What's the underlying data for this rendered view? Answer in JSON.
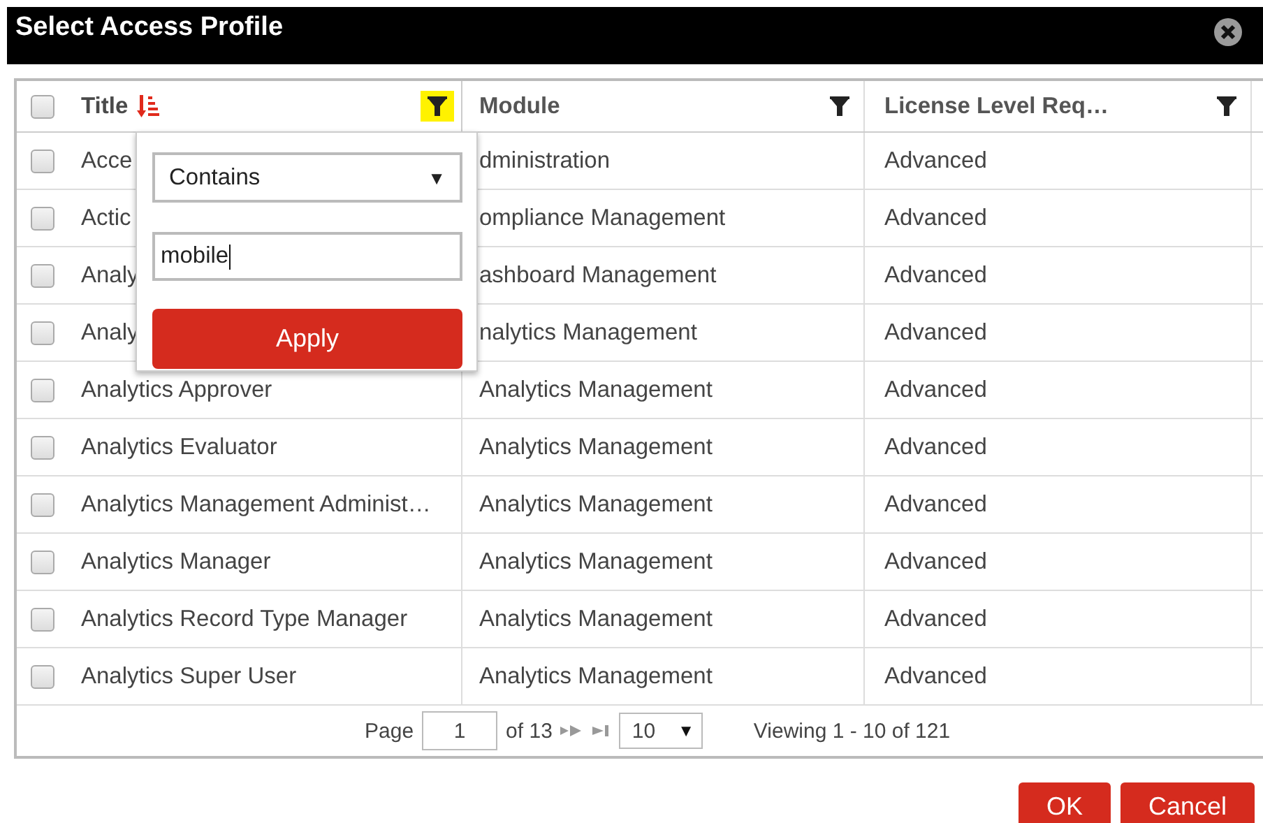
{
  "window": {
    "title": "Select Access Profile"
  },
  "table": {
    "all_checked": false,
    "columns": [
      {
        "label": "Title",
        "sorted": true,
        "filter_active": true
      },
      {
        "label": "Module",
        "sorted": false,
        "filter_active": false
      },
      {
        "label": "License Level Req…",
        "sorted": false,
        "filter_active": false
      }
    ],
    "rows": [
      {
        "checked": false,
        "cells": [
          "Acce",
          "dministration",
          "Advanced"
        ]
      },
      {
        "checked": false,
        "cells": [
          "Actic",
          "ompliance Management",
          "Advanced"
        ]
      },
      {
        "checked": false,
        "cells": [
          "Analy",
          "ashboard Management",
          "Advanced"
        ]
      },
      {
        "checked": false,
        "cells": [
          "Analy",
          "nalytics Management",
          "Advanced"
        ]
      },
      {
        "checked": false,
        "cells": [
          "Analytics Approver",
          "Analytics Management",
          "Advanced"
        ]
      },
      {
        "checked": false,
        "cells": [
          "Analytics Evaluator",
          "Analytics Management",
          "Advanced"
        ]
      },
      {
        "checked": false,
        "cells": [
          "Analytics Management Administ…",
          "Analytics Management",
          "Advanced"
        ]
      },
      {
        "checked": false,
        "cells": [
          "Analytics Manager",
          "Analytics Management",
          "Advanced"
        ]
      },
      {
        "checked": false,
        "cells": [
          "Analytics Record Type Manager",
          "Analytics Management",
          "Advanced"
        ]
      },
      {
        "checked": false,
        "cells": [
          "Analytics Super User",
          "Analytics Management",
          "Advanced"
        ]
      }
    ]
  },
  "filter_popup": {
    "operator": "Contains",
    "operator_caret": "▼",
    "value": "mobile",
    "apply": "Apply"
  },
  "pager": {
    "page_label": "Page",
    "page": "1",
    "of": "of 13",
    "page_size": "10",
    "page_size_caret": "▼",
    "viewing": "Viewing 1 - 10 of 121"
  },
  "buttons": [
    "OK",
    "Cancel"
  ]
}
